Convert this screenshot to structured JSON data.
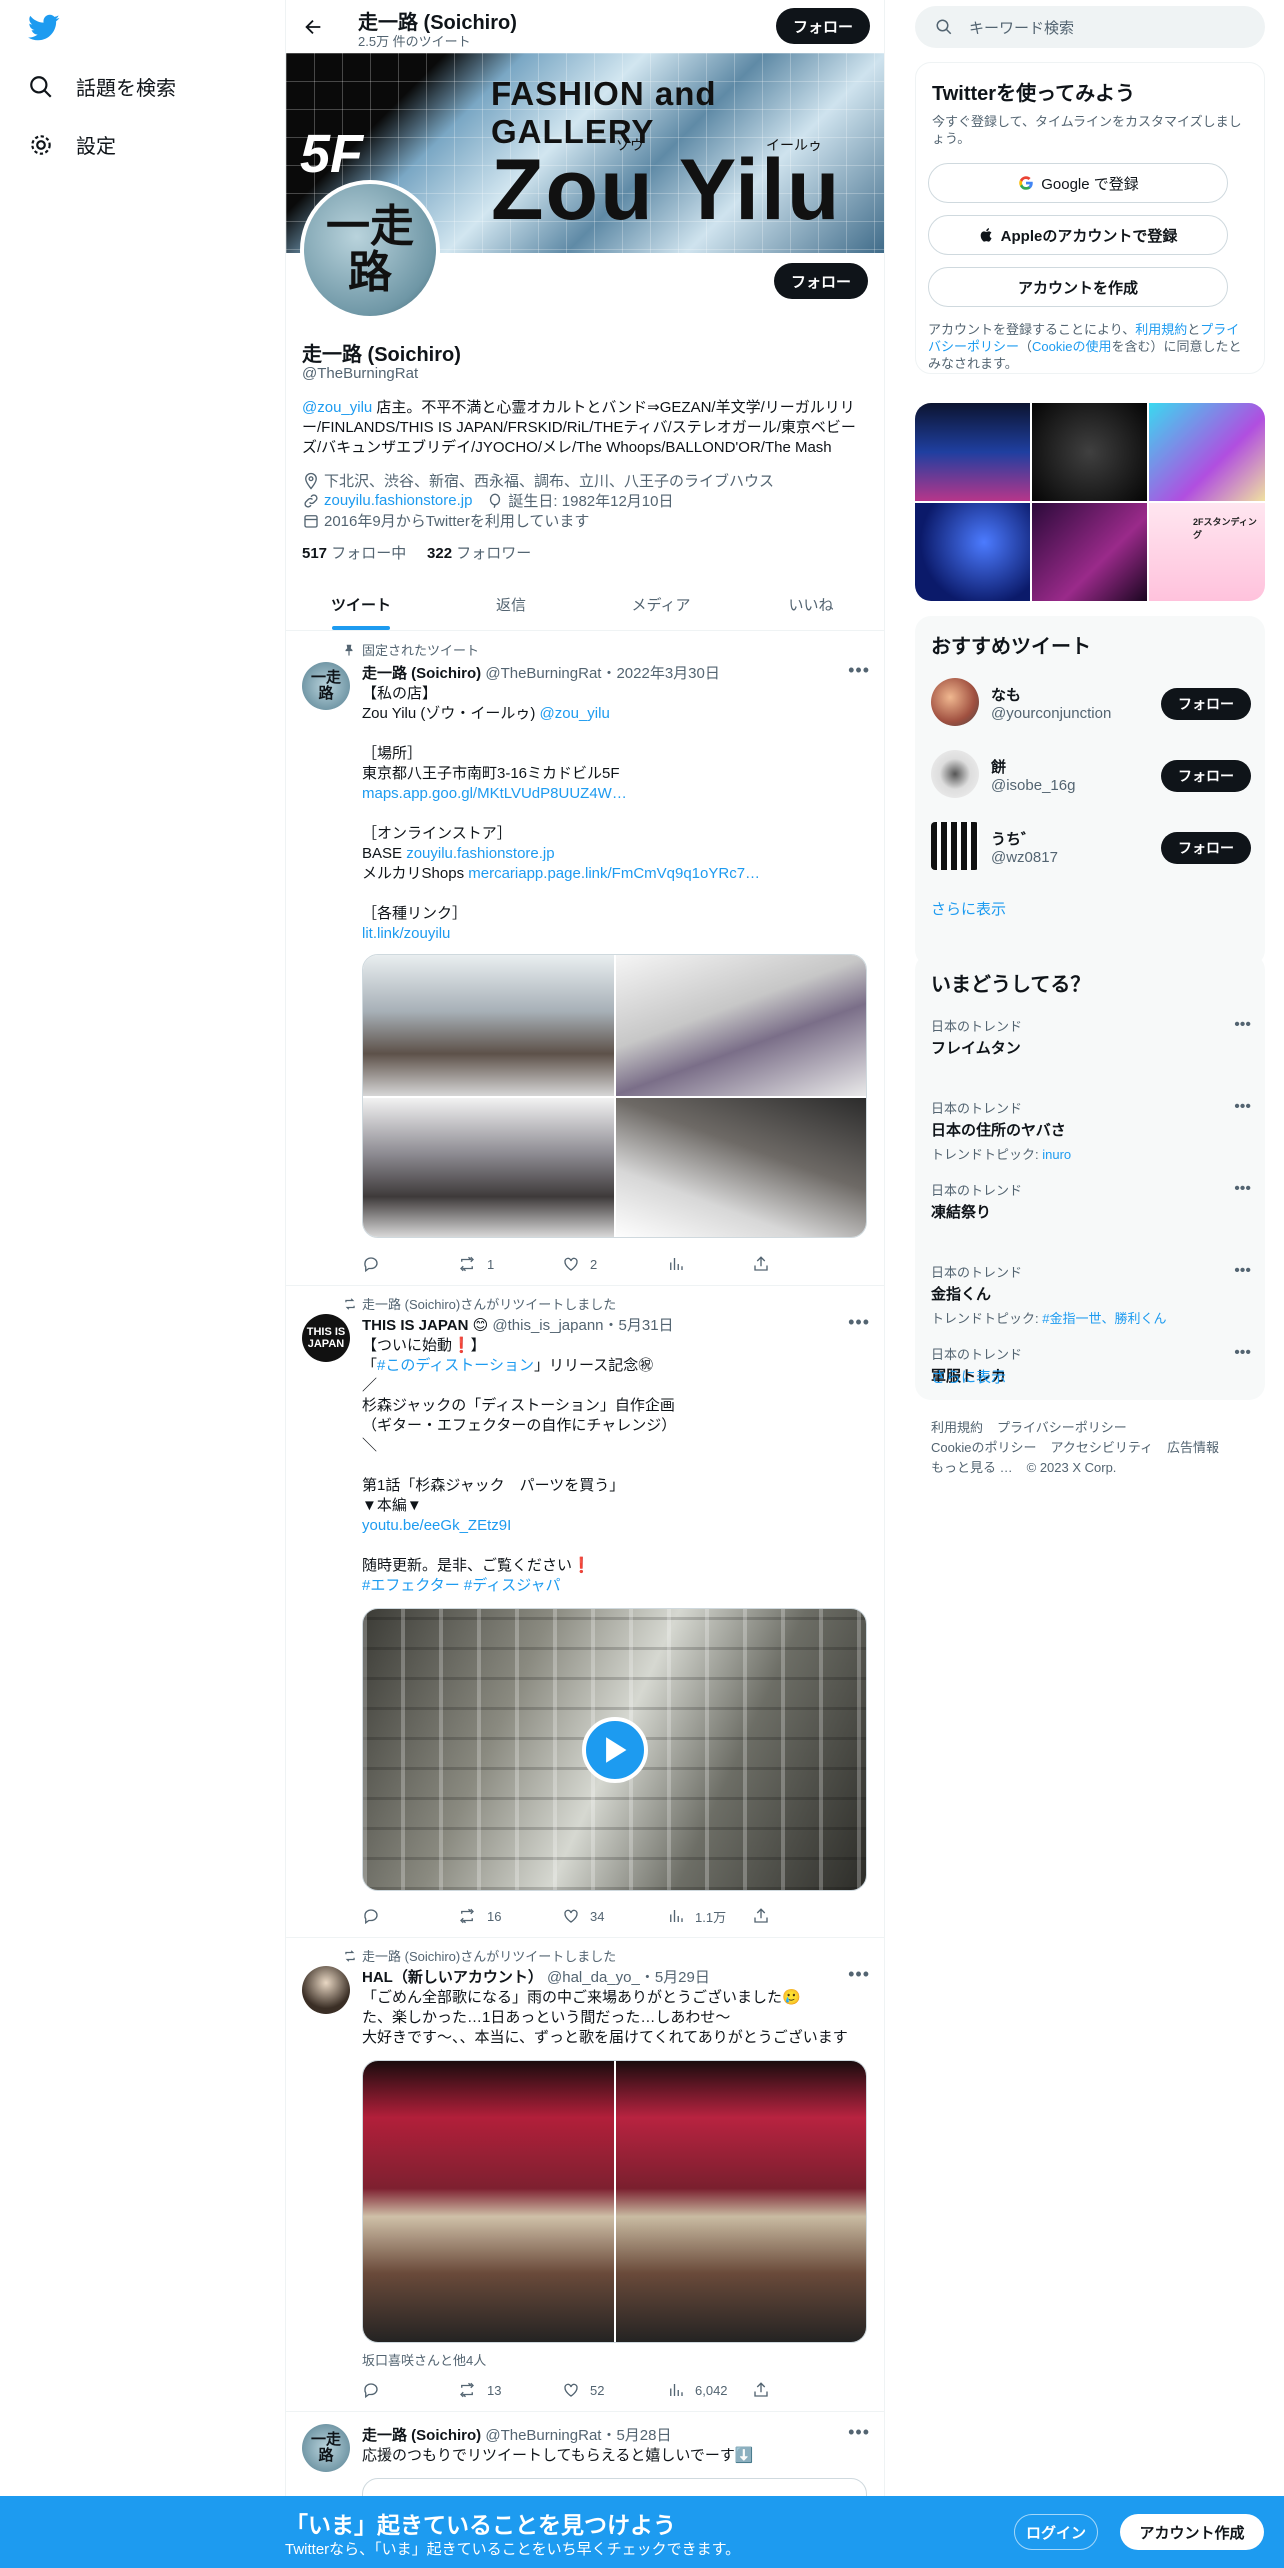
{
  "nav": {
    "explore": "話題を検索",
    "settings": "設定"
  },
  "header": {
    "name": "走一路 (Soichiro)",
    "tweet_count": "2.5万 件のツイート",
    "follow": "フォロー"
  },
  "banner": {
    "floor": "5F",
    "line1": "FASHION and GALLERY",
    "line2": "Zou Yilu",
    "ruby1": "ゾウ",
    "ruby2": "イールゥ"
  },
  "profile": {
    "avatar_text": "一走\n路",
    "follow": "フォロー",
    "name": "走一路 (Soichiro)",
    "handle": "@TheBurningRat",
    "bio_mention": "@zou_yilu",
    "bio_text": " 店主。不平不満と心霊オカルトとバンド⇒GEZAN/羊文学/リーガルリリー/FINLANDS/THIS IS JAPAN/FRSKID/RiL/THEティバ/ステレオガール/東京ベビーズ/バキュンザエブリデイ/JYOCHO/メレ/The Whoops/BALLOND'OR/The Mash",
    "location": "下北沢、渋谷、新宿、西永福、調布、立川、八王子のライブハウス",
    "website": "zouyilu.fashionstore.jp",
    "birthday": "誕生日: 1982年12月10日",
    "joined": "2016年9月からTwitterを利用しています",
    "following_count": "517",
    "following_label": " フォロー中",
    "followers_count": "322",
    "followers_label": " フォロワー"
  },
  "tabs": [
    "ツイート",
    "返信",
    "メディア",
    "いいね"
  ],
  "tweets": [
    {
      "context": "固定されたツイート",
      "avatar_text": "一走\n路",
      "name": "走一路 (Soichiro)",
      "handle": "@TheBurningRat",
      "date": "・2022年3月30日",
      "body": [
        {
          "t": "【私の店】\nZou Yilu (ゾウ・イールゥ) "
        },
        {
          "l": "@zou_yilu"
        },
        {
          "t": "\n\n［場所］\n東京都八王子市南町3-16ミカドビル5F\n"
        },
        {
          "l": "maps.app.goo.gl/MKtLVUdP8UUZ4W…"
        },
        {
          "t": "\n\n［オンラインストア］\nBASE "
        },
        {
          "l": "zouyilu.fashionstore.jp"
        },
        {
          "t": "\nメルカリShops "
        },
        {
          "l": "mercariapp.page.link/FmCmVq9q1oYRc7…"
        },
        {
          "t": "\n\n［各種リンク］\n"
        },
        {
          "l": "lit.link/zouyilu"
        }
      ],
      "reply": "",
      "retweet": "1",
      "like": "2",
      "views": ""
    },
    {
      "context": "走一路 (Soichiro)さんがリツイートしました",
      "avatar_text": "THIS IS\nJAPAN",
      "name": "THIS IS JAPAN 😊",
      "handle": "@this_is_japann",
      "date": "・5月31日",
      "body": [
        {
          "t": "【ついに始動❗】\n「"
        },
        {
          "l": "#このディストーション"
        },
        {
          "t": "」リリース記念㊗\n／\n杉森ジャックの「ディストーション」自作企画\n（ギター・エフェクターの自作にチャレンジ）\n＼\n\n第1話「杉森ジャック　パーツを買う」\n▼本編▼\n"
        },
        {
          "l": "youtu.be/eeGk_ZEtz9I"
        },
        {
          "t": "\n\n随時更新。是非、ご覧ください❗\n"
        },
        {
          "l": "#エフェクター #ディスジャパ"
        }
      ],
      "reply": "",
      "retweet": "16",
      "like": "34",
      "views": "1.1万"
    },
    {
      "context": "走一路 (Soichiro)さんがリツイートしました",
      "avatar_text": "",
      "name": "HAL（新しいアカウント）",
      "handle": "@hal_da_yo_",
      "date": "・5月29日",
      "body": [
        {
          "t": "「ごめん全部歌になる」雨の中ご来場ありがとうございました🥲\nた、楽しかった…1日あっという間だった…しあわせ〜\n大好きです〜、、本当に、ずっと歌を届けてくれてありがとうございます"
        }
      ],
      "caption": "坂口喜咲さんと他4人",
      "reply": "",
      "retweet": "13",
      "like": "52",
      "views": "6,042"
    },
    {
      "context": "",
      "avatar_text": "一走\n路",
      "name": "走一路 (Soichiro)",
      "handle": "@TheBurningRat",
      "date": "・5月28日",
      "body": [
        {
          "t": "応援のつもりでリツイートしてもらえると嬉しいでーす⬇️"
        }
      ]
    }
  ],
  "right": {
    "search_placeholder": "キーワード検索",
    "signup": {
      "title": "Twitterを使ってみよう",
      "sub": "今すぐ登録して、タイムラインをカスタマイズしましょう。",
      "google": "Google で登録",
      "apple": "Appleのアカウントで登録",
      "create": "アカウントを作成",
      "terms_pre": "アカウントを登録することにより、",
      "terms_link1": "利用規約",
      "terms_mid": "と",
      "terms_link2": "プライバシーポリシー",
      "terms_mid2": "（",
      "terms_link3": "Cookieの使用",
      "terms_post": "を含む）に同意したとみなされます。"
    },
    "media_overlay": "2Fスタンディング",
    "suggest_title": "おすすめツイート",
    "suggestions": [
      {
        "name": "なも",
        "handle": "@yourconjunction"
      },
      {
        "name": "餅",
        "handle": "@isobe_16g"
      },
      {
        "name": "うち゛",
        "handle": "@wz0817"
      }
    ],
    "follow": "フォロー",
    "show_more": "さらに表示",
    "trends_title": "いまどうしてる？",
    "trends": [
      {
        "meta": "日本のトレンド",
        "name": "フレイムタン",
        "sub_label": "",
        "sub_link": ""
      },
      {
        "meta": "日本のトレンド",
        "name": "日本の住所のヤバさ",
        "sub_label": "トレンドトピック: ",
        "sub_link": "inuro"
      },
      {
        "meta": "日本のトレンド",
        "name": "凍結祭り",
        "sub_label": "",
        "sub_link": ""
      },
      {
        "meta": "日本のトレンド",
        "name": "金指くん",
        "sub_label": "トレンドトピック: ",
        "sub_link": "#金指一世、勝利くん"
      },
      {
        "meta": "日本のトレンド",
        "name": "軍服トレカ",
        "sub_label": "",
        "sub_link": ""
      }
    ],
    "footer": [
      "利用規約",
      "プライバシーポリシー",
      "Cookieのポリシー",
      "アクセシビリティ",
      "広告情報",
      "もっと見る …",
      "© 2023 X Corp."
    ]
  },
  "bottom": {
    "title": "「いま」起きていることを見つけよう",
    "sub": "Twitterなら、「いま」起きていることをいち早くチェックできます。",
    "login": "ログイン",
    "signup": "アカウント作成"
  },
  "colors": {
    "accent": "#1d9bf0",
    "text": "#0f1419",
    "muted": "#536471"
  }
}
